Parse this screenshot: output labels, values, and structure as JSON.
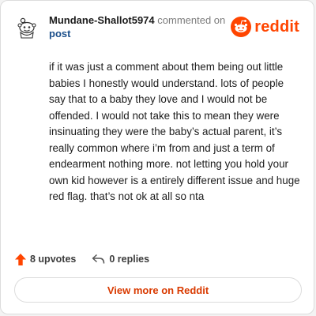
{
  "header": {
    "username": "Mundane-Shallot5974",
    "action_text": "commented on",
    "post_link": "post",
    "brand": "reddit"
  },
  "comment": {
    "body": "if it was just a comment about them being out little babies I honestly would understand. lots of people say that to a baby they love and I would not be offended. I would not take this to mean they were insinuating they were the baby’s actual parent, it’s really common where i’m from and just a term of endearment nothing more. not letting you hold your own kid however is a entirely different issue and huge red flag. that’s not ok at all so nta"
  },
  "footer": {
    "upvotes": "8 upvotes",
    "replies": "0 replies"
  },
  "view_more": "View more on Reddit",
  "colors": {
    "brand": "#ff4500",
    "upvote": "#ff4500",
    "link": "#1a4e8a",
    "view_more_text": "#d93a00"
  }
}
